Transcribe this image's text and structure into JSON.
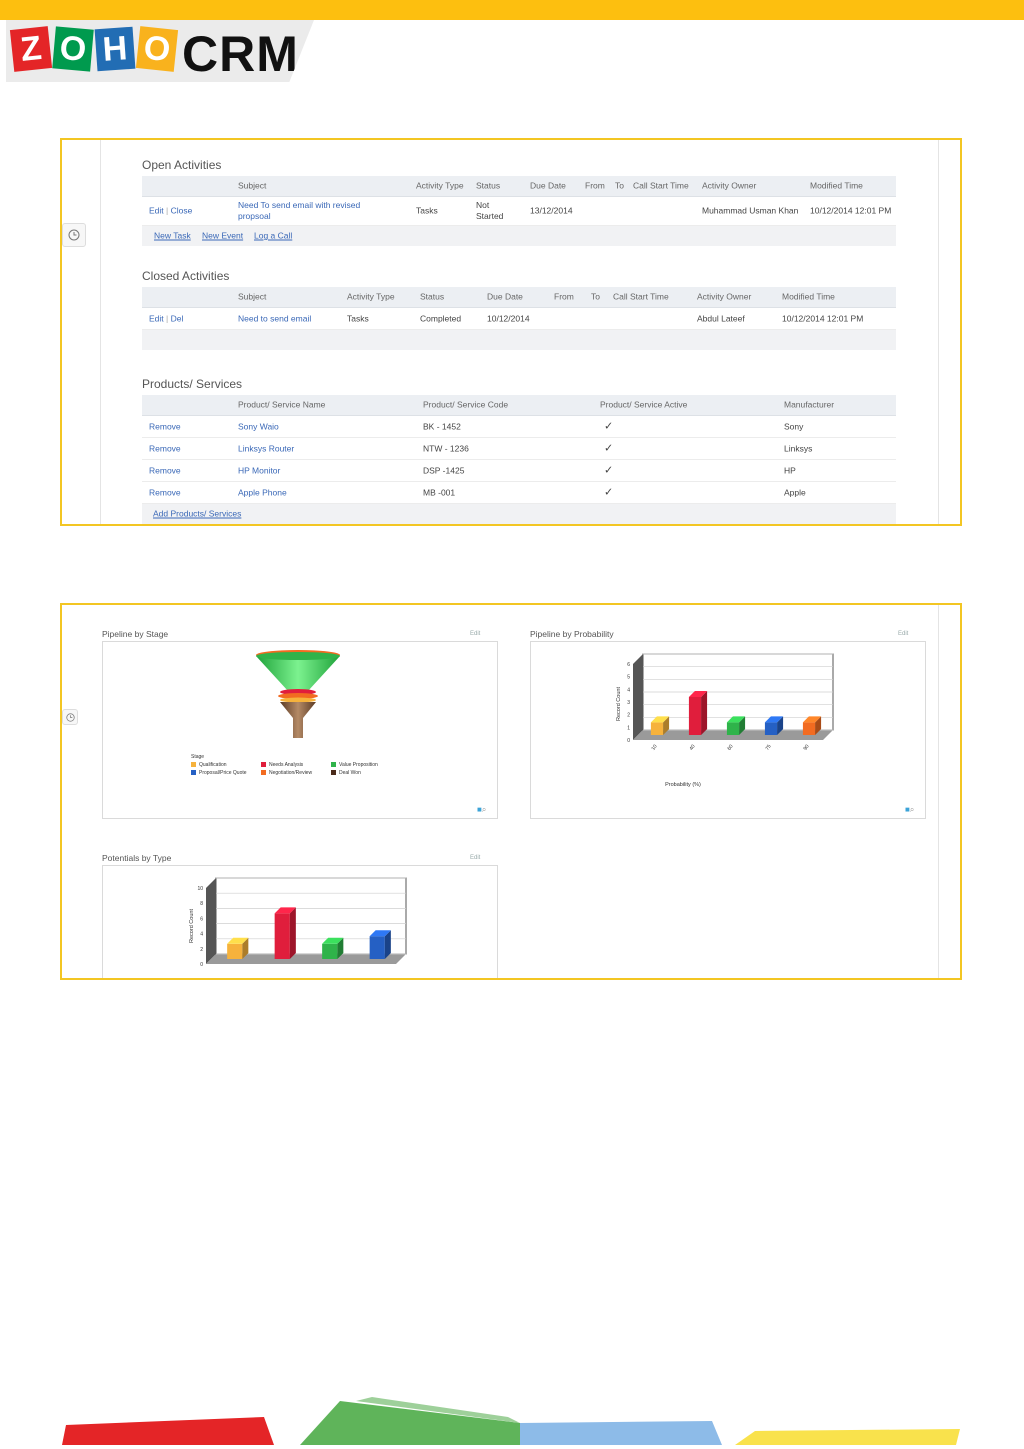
{
  "brand": {
    "logo_letters": [
      "Z",
      "O",
      "H",
      "O"
    ],
    "logo_colors": [
      "#e42527",
      "#009a4e",
      "#226db4",
      "#f9b21d"
    ],
    "product": "CRM",
    "bar_color": "#fdbf0f"
  },
  "open_activities": {
    "title": "Open Activities",
    "headers": [
      "Subject",
      "Activity Type",
      "Status",
      "Due Date",
      "From",
      "To",
      "Call Start Time",
      "Activity Owner",
      "Modified Time"
    ],
    "rows": [
      {
        "edit": "Edit",
        "action": "Close",
        "subject": "Need To send email with revised propsoal",
        "type": "Tasks",
        "status": "Not Started",
        "due": "13/12/2014",
        "from": "",
        "to": "",
        "call_start": "",
        "owner": "Muhammad Usman Khan",
        "modified": "10/12/2014 12:01 PM"
      }
    ],
    "footer_links": [
      "New Task",
      "New Event",
      "Log a Call"
    ]
  },
  "closed_activities": {
    "title": "Closed Activities",
    "headers": [
      "Subject",
      "Activity Type",
      "Status",
      "Due Date",
      "From",
      "To",
      "Call Start Time",
      "Activity Owner",
      "Modified Time"
    ],
    "rows": [
      {
        "edit": "Edit",
        "action": "Del",
        "subject": "Need to send email",
        "type": "Tasks",
        "status": "Completed",
        "due": "10/12/2014",
        "from": "",
        "to": "",
        "call_start": "",
        "owner": "Abdul Lateef",
        "modified": "10/12/2014 12:01 PM"
      }
    ]
  },
  "products": {
    "title": "Products/ Services",
    "headers": [
      "Product/ Service Name",
      "Product/ Service Code",
      "Product/ Service Active",
      "Manufacturer"
    ],
    "rows": [
      {
        "action": "Remove",
        "name": "Sony Waio",
        "code": "BK - 1452",
        "active": "✓",
        "manufacturer": "Sony"
      },
      {
        "action": "Remove",
        "name": "Linksys Router",
        "code": "NTW - 1236",
        "active": "✓",
        "manufacturer": "Linksys"
      },
      {
        "action": "Remove",
        "name": "HP Monitor",
        "code": "DSP -1425",
        "active": "✓",
        "manufacturer": "HP"
      },
      {
        "action": "Remove",
        "name": "Apple Phone",
        "code": "MB -001",
        "active": "✓",
        "manufacturer": "Apple"
      }
    ],
    "footer_link": "Add Products/ Services"
  },
  "dashboard": {
    "pipeline_stage": {
      "title": "Pipeline by Stage",
      "edit": "Edit",
      "legend_title": "Stage",
      "legend": [
        {
          "label": "Qualification",
          "color": "#f6b23c"
        },
        {
          "label": "Needs Analysis",
          "color": "#e01e3c"
        },
        {
          "label": "Value Proposition",
          "color": "#2fb34a"
        },
        {
          "label": "Proposal/Price Quote",
          "color": "#2560c4"
        },
        {
          "label": "Negotiation/Review",
          "color": "#f26b21"
        },
        {
          "label": "Deal Won",
          "color": "#4a2a1a"
        }
      ]
    },
    "pipeline_probability": {
      "title": "Pipeline by Probability",
      "edit": "Edit",
      "ylabel": "Record Count",
      "xlabel": "Probability (%)"
    },
    "potentials_type": {
      "title": "Potentials by Type",
      "edit": "Edit",
      "ylabel": "Record Count"
    }
  },
  "chart_data": [
    {
      "type": "bar",
      "title": "Pipeline by Probability",
      "xlabel": "Probability (%)",
      "ylabel": "Record Count",
      "categories": [
        "10",
        "40",
        "60",
        "75",
        "90"
      ],
      "values": [
        1,
        3,
        1,
        1,
        1
      ],
      "colors": [
        "#f6b23c",
        "#e01e3c",
        "#2fb34a",
        "#2560c4",
        "#f26b21"
      ],
      "ylim": [
        0,
        6
      ],
      "yticks": [
        0,
        1,
        2,
        3,
        4,
        5,
        6
      ]
    },
    {
      "type": "bar",
      "title": "Potentials by Type",
      "ylabel": "Record Count",
      "categories": [
        "",
        "",
        "",
        ""
      ],
      "values": [
        2,
        6,
        2,
        3
      ],
      "colors": [
        "#f6b23c",
        "#e01e3c",
        "#2fb34a",
        "#2560c4"
      ],
      "ylim": [
        0,
        10
      ],
      "yticks": [
        0,
        2,
        4,
        6,
        8,
        10
      ]
    }
  ]
}
